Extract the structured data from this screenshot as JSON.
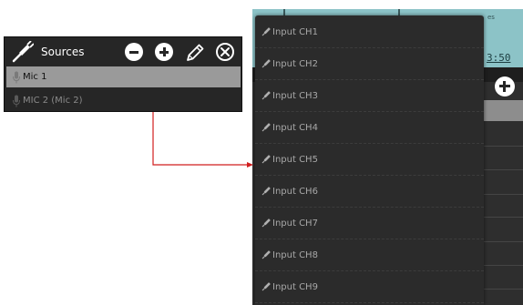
{
  "sources_panel": {
    "title": "Sources",
    "icons": {
      "header": "plug-icon",
      "remove": "minus-circle-icon",
      "add": "plus-circle-icon",
      "edit": "pencil-icon",
      "close": "close-circle-icon",
      "row": "microphone-icon"
    },
    "rows": [
      {
        "label": "Mic 1",
        "selected": true
      },
      {
        "label": "MIC 2 (Mic 2)",
        "selected": false
      }
    ]
  },
  "background_app": {
    "time_fragment": "3:50",
    "caption_fragment": "es"
  },
  "dropdown": {
    "item_icon": "plug-icon",
    "items": [
      "Input CH1",
      "Input CH2",
      "Input CH3",
      "Input CH4",
      "Input CH5",
      "Input CH6",
      "Input CH7",
      "Input CH8",
      "Input CH9"
    ]
  },
  "colors": {
    "panel_bg": "#262626",
    "selected_row": "#9a9a9a",
    "dropdown_bg": "#2b2b2b",
    "teal": "#8cc3c7",
    "arrow": "#d11f1f"
  }
}
